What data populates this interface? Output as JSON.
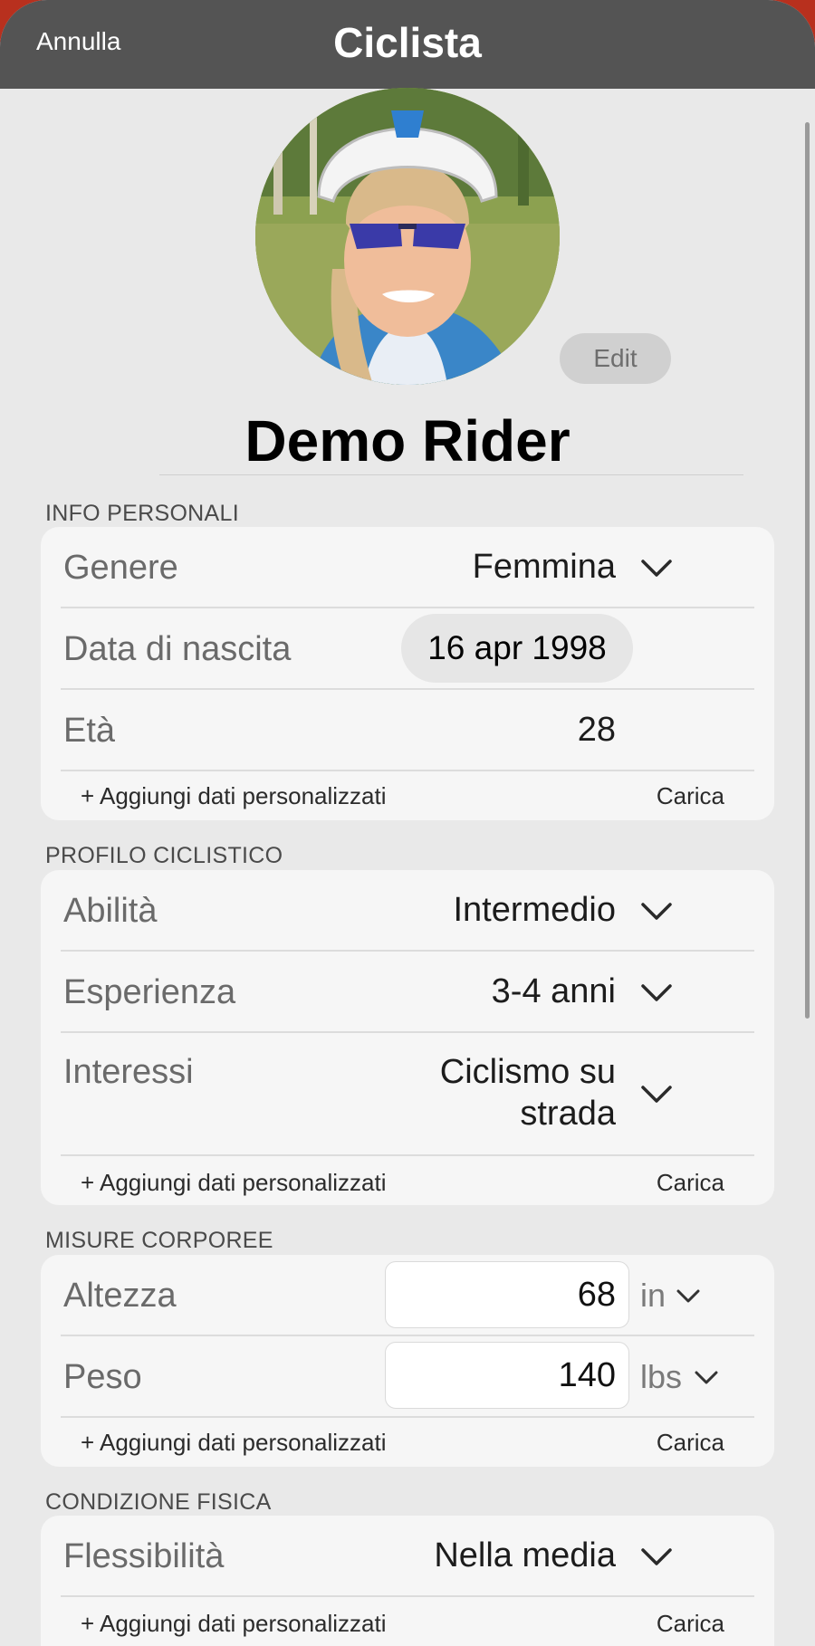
{
  "nav": {
    "cancel": "Annulla",
    "title": "Ciclista"
  },
  "profile": {
    "edit": "Edit",
    "name": "Demo Rider"
  },
  "personal": {
    "header": "INFO PERSONALI",
    "gender_label": "Genere",
    "gender_value": "Femmina",
    "birth_label": "Data di nascita",
    "birth_value": "16 apr 1998",
    "age_label": "Età",
    "age_value": "28",
    "add": "+ Aggiungi dati personalizzati",
    "load": "Carica"
  },
  "cycling": {
    "header": "PROFILO CICLISTICO",
    "ability_label": "Abilità",
    "ability_value": "Intermedio",
    "experience_label": "Esperienza",
    "experience_value": "3-4 anni",
    "interests_label": "Interessi",
    "interests_value_1": "Ciclismo su",
    "interests_value_2": "strada",
    "add": "+ Aggiungi dati personalizzati",
    "load": "Carica"
  },
  "body": {
    "header": "MISURE CORPOREE",
    "height_label": "Altezza",
    "height_value": "68",
    "height_unit": "in",
    "weight_label": "Peso",
    "weight_value": "140",
    "weight_unit": "lbs",
    "add": "+ Aggiungi dati personalizzati",
    "load": "Carica"
  },
  "fitness": {
    "header": "CONDIZIONE FISICA",
    "flex_label": "Flessibilità",
    "flex_value": "Nella media",
    "add": "+ Aggiungi dati personalizzati",
    "load": "Carica"
  },
  "colors": {
    "nav_bg": "#545454",
    "bg": "#e9e9e9",
    "card": "#f6f6f6",
    "accent_red": "#b8301e"
  },
  "icons": {
    "dropdown": "chevron-down-icon",
    "avatar": "profile-photo"
  }
}
